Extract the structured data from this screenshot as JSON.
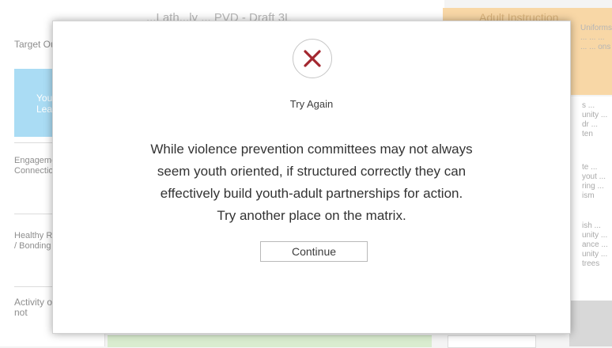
{
  "background": {
    "top_header": "...Lath...ly ... PVD - Draft 3L",
    "right_header": "Adult Instruction",
    "left_rows": [
      "Target Outcomes",
      "Youth Leadership",
      "Engagement and Connection",
      "Healthy Relationships / Bonding",
      "Activity options do not"
    ],
    "right_column_top": "Uniforms ... ... ... ... ... ons",
    "right_cells": [
      "s ... unity ... dr ... ten",
      "te ... yout ... ring ... ism",
      "ish ... unity ... ance ... unity ... trees"
    ],
    "colors": {
      "left_blue": "#aadcf4",
      "right_header": "#f8d7a6",
      "bottom_green": "#d9eccf"
    }
  },
  "dialog": {
    "icon": "close-x-icon",
    "icon_color": "#a3272f",
    "status": "Try Again",
    "message_lines": [
      "While violence prevention committees may not always",
      "seem youth oriented, if structured correctly they can",
      "effectively build youth-adult partnerships for action.",
      "Try another place on the matrix."
    ],
    "continue_label": "Continue"
  }
}
